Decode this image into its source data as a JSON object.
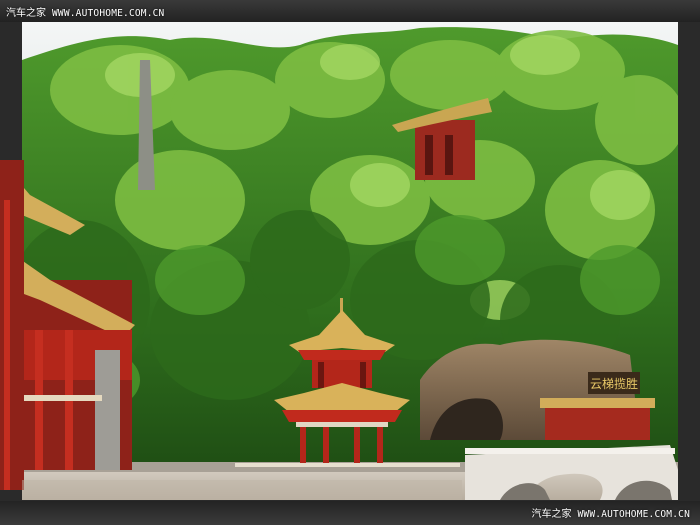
{
  "watermark_top": {
    "brand": "汽车之家",
    "url": "WWW.AUTOHOME.COM.CN"
  },
  "watermark_bottom": {
    "brand": "汽车之家",
    "url": "WWW.AUTOHOME.COM.CN"
  },
  "plaque_text": "云梯揽胜",
  "colors": {
    "foliage_dark": "#1f4f14",
    "foliage_mid": "#3f8a25",
    "foliage_light": "#8cc94a",
    "temple_red": "#b8241c",
    "roof_gold": "#d9b25a",
    "sky": "#eef2f3",
    "rock": "#8a7356",
    "plaza": "#c9c1b5"
  }
}
